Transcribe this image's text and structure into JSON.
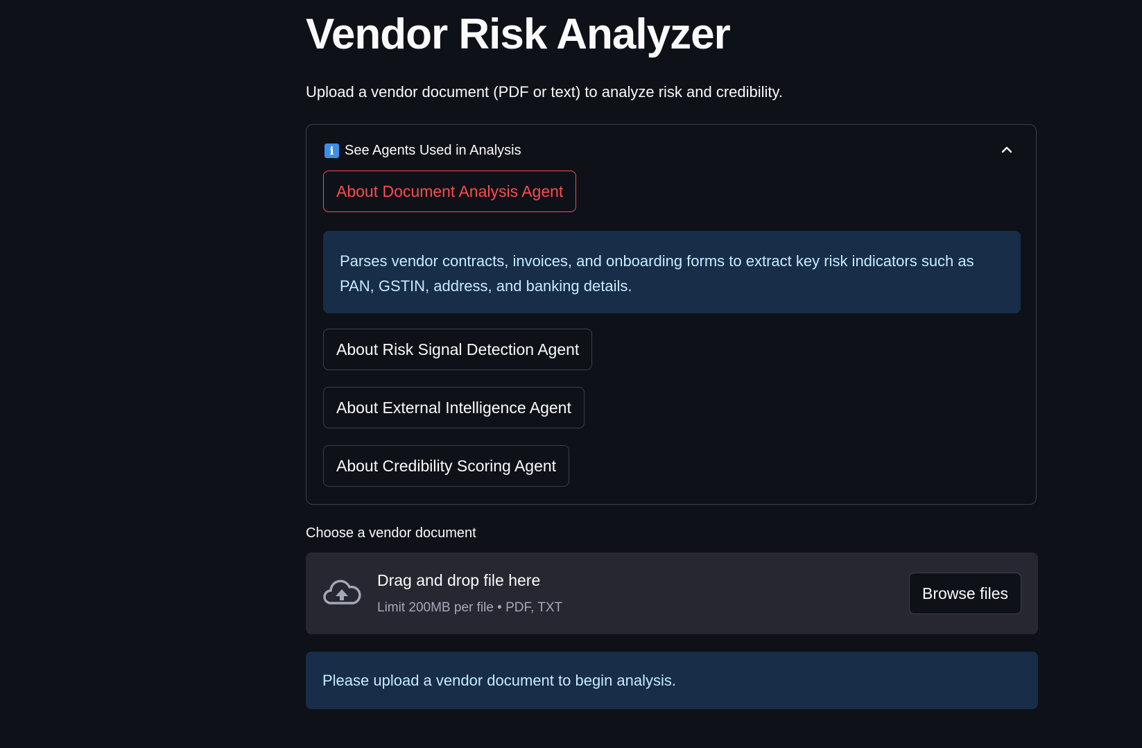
{
  "page": {
    "title": "Vendor Risk Analyzer",
    "subtitle": "Upload a vendor document (PDF or text) to analyze risk and credibility."
  },
  "expander": {
    "icon": "info-icon",
    "icon_glyph": "i",
    "label": "See Agents Used in Analysis",
    "state": "expanded",
    "toggle_icon": "chevron-up-icon",
    "agents": [
      {
        "label": "About Document Analysis Agent",
        "active": true
      },
      {
        "label": "About Risk Signal Detection Agent",
        "active": false
      },
      {
        "label": "About External Intelligence Agent",
        "active": false
      },
      {
        "label": "About Credibility Scoring Agent",
        "active": false
      }
    ],
    "active_info": "Parses vendor contracts, invoices, and onboarding forms to extract key risk indicators such as PAN, GSTIN, address, and banking details."
  },
  "uploader": {
    "label": "Choose a vendor document",
    "icon": "cloud-upload-icon",
    "drag_text": "Drag and drop file here",
    "limit_text": "Limit 200MB per file • PDF, TXT",
    "browse_label": "Browse files"
  },
  "notice": {
    "text": "Please upload a vendor document to begin analysis."
  },
  "colors": {
    "background": "#0e1117",
    "accent_red": "#ff4b4b",
    "info_bg": "#172d48",
    "info_text": "#c7ebff",
    "dropzone_bg": "#262730"
  }
}
